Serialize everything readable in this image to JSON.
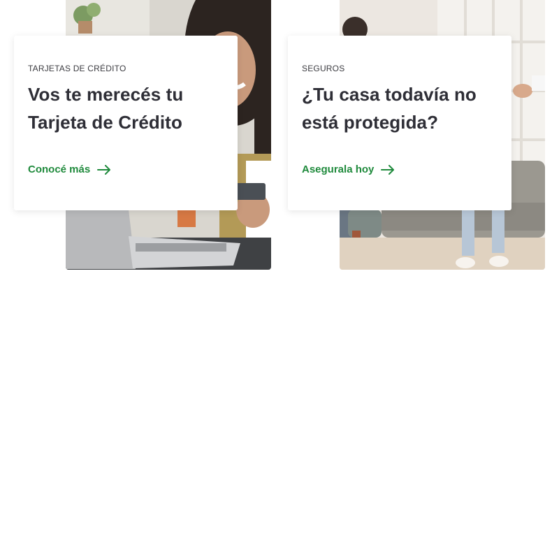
{
  "promos": [
    {
      "category": "TARJETAS DE CRÉDITO",
      "title": "Vos te merecés tu Tarjeta de Crédito",
      "cta_label": "Conocé más",
      "cta_icon": "arrow-right-icon",
      "image_subject": "woman-with-credit-card-and-laptop"
    },
    {
      "category": "SEGUROS",
      "title": "¿Tu casa todavía no está protegida?",
      "cta_label": "Asegurala hoy",
      "cta_icon": "arrow-right-icon",
      "image_subject": "family-in-living-room"
    }
  ],
  "colors": {
    "accent": "#1f8a3c",
    "title": "#2e2e36",
    "eyebrow": "#3b3b40",
    "background": "#ffffff"
  }
}
